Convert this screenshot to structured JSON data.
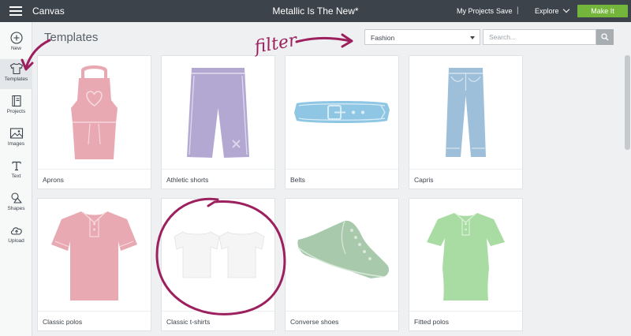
{
  "topbar": {
    "app_name": "Canvas",
    "project_title": "Metallic Is The New*",
    "my_projects": "My Projects",
    "save": "Save",
    "separator": "|",
    "explore": "Explore",
    "make_it": "Make It"
  },
  "sidebar": {
    "items": [
      {
        "label": "New",
        "icon": "plus-circle-icon"
      },
      {
        "label": "Templates",
        "icon": "tshirt-icon",
        "active": true
      },
      {
        "label": "Projects",
        "icon": "notebook-icon"
      },
      {
        "label": "Images",
        "icon": "image-icon"
      },
      {
        "label": "Text",
        "icon": "text-t-icon"
      },
      {
        "label": "Shapes",
        "icon": "shapes-icon"
      },
      {
        "label": "Upload",
        "icon": "cloud-upload-icon"
      }
    ]
  },
  "main": {
    "title": "Templates",
    "filter_value": "Fashion",
    "search_placeholder": "Search..."
  },
  "templates": [
    {
      "name": "Aprons",
      "color": "#e8a9b3"
    },
    {
      "name": "Athletic shorts",
      "color": "#b2a8d2"
    },
    {
      "name": "Belts",
      "color": "#8fc6e3"
    },
    {
      "name": "Capris",
      "color": "#9dbfd9"
    },
    {
      "name": "Classic polos",
      "color": "#e8a9b3"
    },
    {
      "name": "Classic t-shirts",
      "color": "#f3f3f3"
    },
    {
      "name": "Converse shoes",
      "color": "#a9c9ad"
    },
    {
      "name": "Fitted polos",
      "color": "#a8dca3"
    }
  ],
  "annotations": {
    "handwritten_note": "filter",
    "ink_color": "#9c1f5e"
  }
}
